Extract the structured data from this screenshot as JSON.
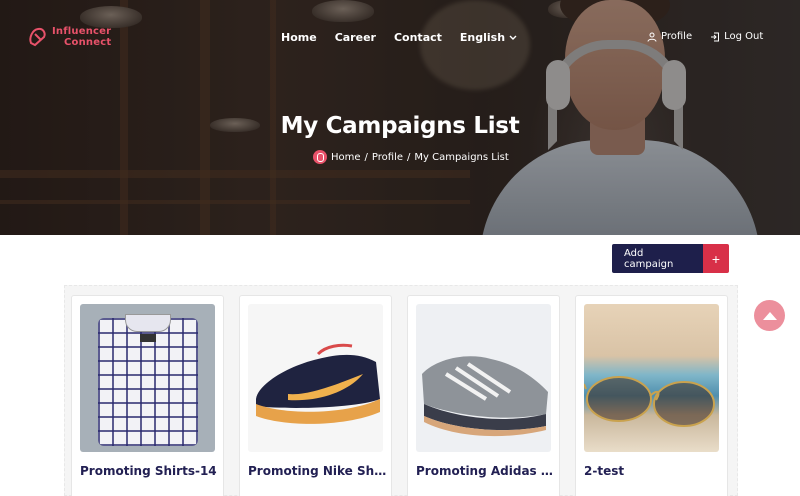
{
  "brand": {
    "line1": "Influencer",
    "line2": "Connect",
    "color": "#e8526a"
  },
  "nav": {
    "items": [
      "Home",
      "Career",
      "Contact"
    ],
    "language": "English",
    "profile": "Profile",
    "logout": "Log Out"
  },
  "hero": {
    "title": "My Campaigns List",
    "breadcrumb": [
      "Home",
      "Profile",
      "My Campaigns List"
    ]
  },
  "actions": {
    "add_campaign": "Add campaign",
    "add_icon": "+"
  },
  "campaigns": [
    {
      "title": "Promoting Shirts-14",
      "image": "shirt"
    },
    {
      "title": "Promoting Nike Shoes",
      "image": "nike-shoe"
    },
    {
      "title": "Promoting Adidas Shoes",
      "image": "adidas-shoe"
    },
    {
      "title": "2-test",
      "image": "sunglasses"
    }
  ],
  "colors": {
    "navy": "#1e1f4b",
    "accent": "#d83048",
    "title_text": "#222053"
  }
}
